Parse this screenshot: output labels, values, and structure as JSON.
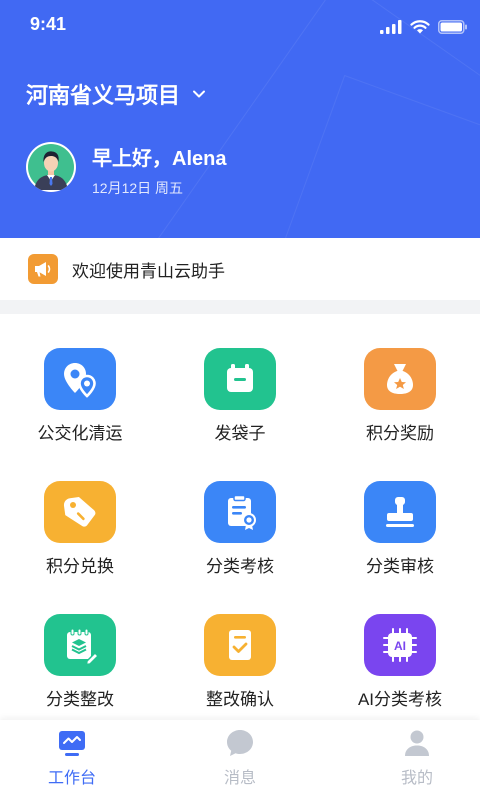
{
  "status_bar": {
    "time": "9:41"
  },
  "header": {
    "project_name": "河南省义马项目",
    "greeting": "早上好，Alena",
    "date": "12月12日  周五"
  },
  "notice": {
    "text": "欢迎使用青山云助手"
  },
  "colors": {
    "brand": "#4169f3",
    "blue": "#3b86f7",
    "green": "#22c38f",
    "orange": "#f49a45",
    "yellow": "#f7b132",
    "purple": "#7a45ef",
    "tab_active": "#3f6cf5",
    "tab_inactive": "#b7bcc6"
  },
  "features": [
    {
      "label": "公交化清运",
      "icon": "location-pin-icon",
      "color": "#3b86f7"
    },
    {
      "label": "发袋子",
      "icon": "bag-icon",
      "color": "#22c38f"
    },
    {
      "label": "积分奖励",
      "icon": "money-bag-icon",
      "color": "#f49a45"
    },
    {
      "label": "积分兑换",
      "icon": "tag-icon",
      "color": "#f7b132"
    },
    {
      "label": "分类考核",
      "icon": "clipboard-badge-icon",
      "color": "#3b86f7"
    },
    {
      "label": "分类审核",
      "icon": "stamp-icon",
      "color": "#3b86f7"
    },
    {
      "label": "分类整改",
      "icon": "notepad-edit-icon",
      "color": "#22c38f"
    },
    {
      "label": "整改确认",
      "icon": "document-check-icon",
      "color": "#f7b132"
    },
    {
      "label": "AI分类考核",
      "icon": "ai-chip-icon",
      "color": "#7a45ef"
    }
  ],
  "tabbar": {
    "tabs": [
      {
        "label": "工作台",
        "icon": "workbench-icon",
        "active": true
      },
      {
        "label": "消息",
        "icon": "message-icon",
        "active": false
      },
      {
        "label": "我的",
        "icon": "profile-icon",
        "active": false
      }
    ]
  }
}
